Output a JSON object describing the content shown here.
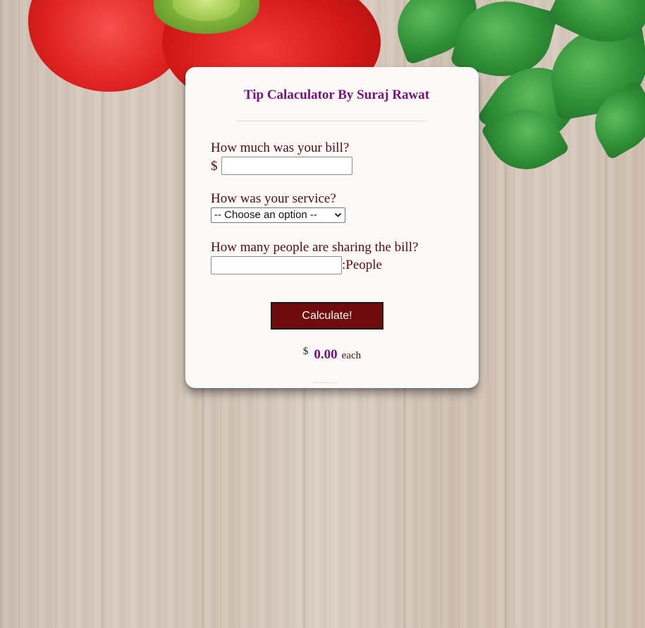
{
  "app": {
    "title": "Tip Calaculator By Suraj Rawat"
  },
  "bill": {
    "question": "How much was your bill?",
    "currency_symbol": "$",
    "value": "",
    "placeholder": ""
  },
  "service": {
    "question": "How was your service?",
    "selected_option": "-- Choose an option --"
  },
  "people": {
    "question": "How many people are sharing the bill?",
    "value": "",
    "placeholder": "",
    "suffix": ":People"
  },
  "calculate": {
    "label": "Calculate!"
  },
  "result": {
    "currency_symbol": "$",
    "amount": "0.00",
    "unit": "each"
  },
  "colors": {
    "title": "#7a0f7d",
    "label_text": "#5a0b0b",
    "button_bg": "#700b0b",
    "button_text": "#ffffff",
    "card_bg": "#fbfaf8"
  },
  "icons": {
    "select_chevron": "chevron-down-icon"
  }
}
